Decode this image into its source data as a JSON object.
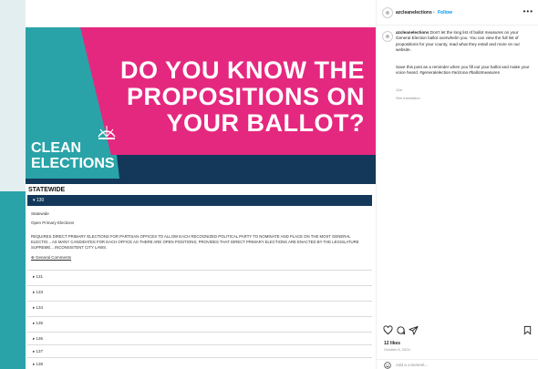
{
  "post_image": {
    "headline": [
      "DO YOU KNOW THE",
      "PROPOSITIONS ON",
      "YOUR BALLOT?"
    ],
    "logo_lines": [
      "CLEAN",
      "ELECTIONS"
    ],
    "colors": {
      "pink": "#e5287f",
      "teal": "#2aa3a8",
      "navy": "#14385a"
    },
    "document": {
      "heading": "STATEWIDE",
      "active_row": "▾ 130",
      "line_1": "Statewide",
      "line_2": "Open Primary Elections",
      "paragraph": "REQUIRES DIRECT PRIMARY ELECTIONS FOR PARTISAN OFFICES TO ALLOW EACH RECOGNIZED POLITICAL PARTY TO NOMINATE AND PLACE ON THE MOST GENERAL ELECTIO... AS MANY CANDIDATES FOR EACH OFFICE AS THERE ARE OPEN POSITIONS; PROVIDES THAT DIRECT PRIMARY ELECTIONS ARE ENACTED BY THE LEGISLATURE SUPREME... INCONSISTENT CITY LAWS.",
      "link": "⊕ General Comments",
      "items": [
        "▸ 131",
        "▸ 133",
        "▸ 134",
        "▸ 135",
        "▸ 136",
        "▸ 137",
        "▸ 138"
      ]
    }
  },
  "instagram": {
    "header": {
      "username": "azcleanelections",
      "dot": "•",
      "follow": "Follow",
      "more": "•••"
    },
    "caption": {
      "username": "azcleanelections",
      "text": "Don't let the long list of ballot measures on your General Election ballot overwhelm you. You can view the full list of propositions for your county, read what they entail and more on our website.",
      "text_2": "Save this post as a reminder when you fill out your ballot and make your voice heard.",
      "hashtags": "#generalelection #arizona #ballotmeasures",
      "time": "11w",
      "see_translation": "See translation"
    },
    "likes": "12 likes",
    "date": "October 8, 2024",
    "comment_placeholder": "Add a comment..."
  }
}
